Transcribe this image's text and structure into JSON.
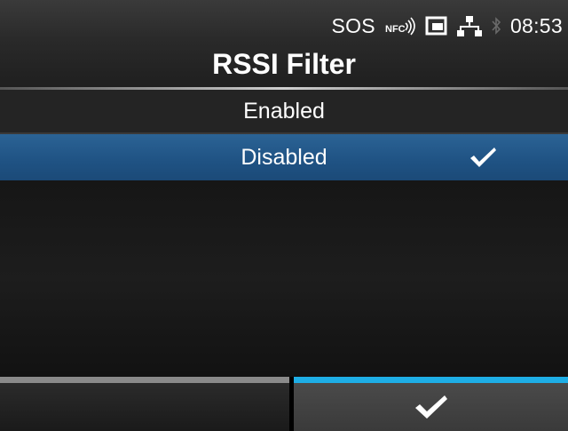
{
  "status_bar": {
    "sos_label": "SOS",
    "nfc_label": "NFC",
    "time": "08:53",
    "icons": [
      "nfc-icon",
      "sd-card-icon",
      "network-icon",
      "bluetooth-icon"
    ]
  },
  "header": {
    "title": "RSSI Filter"
  },
  "options": [
    {
      "label": "Enabled",
      "selected": false
    },
    {
      "label": "Disabled",
      "selected": true
    }
  ],
  "softkeys": {
    "left": {
      "icon": ""
    },
    "right": {
      "icon": "check-icon"
    }
  },
  "colors": {
    "selected_row": "#1f5283",
    "accent_blue": "#1eaee6",
    "inactive_bar": "#8a8a8a"
  }
}
